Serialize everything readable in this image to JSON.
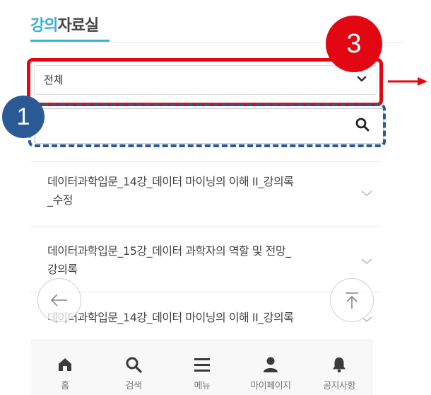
{
  "page": {
    "title_highlight": "강의",
    "title_rest": "자료실"
  },
  "annotations": {
    "badge_3": "3",
    "badge_1": "1",
    "select_box_color": "#e30613",
    "search_box_color": "#2a5a96"
  },
  "filter": {
    "selected": "전체"
  },
  "search": {
    "placeholder": ""
  },
  "list": {
    "items": [
      {
        "line1": "데이터과학입문_14강_데이터 마이닝의 이해 II_강의록",
        "line2": "_수정"
      },
      {
        "line1": "데이터과학입문_15강_데이터 과학자의 역할 및 전망_",
        "line2": "강의록"
      },
      {
        "line1": "데이터과학입문_14강_데이터 마이닝의 이해 II_강의록",
        "line2": ""
      }
    ]
  },
  "floating": {
    "back_icon": "arrow-left-icon",
    "top_icon": "arrow-up-to-top-icon"
  },
  "tabbar": {
    "tabs": [
      {
        "label": "홈",
        "icon": "home-icon"
      },
      {
        "label": "검색",
        "icon": "search-icon"
      },
      {
        "label": "메뉴",
        "icon": "menu-icon"
      },
      {
        "label": "마이페이지",
        "icon": "user-icon"
      },
      {
        "label": "공지사항",
        "icon": "bell-icon"
      }
    ]
  },
  "colors": {
    "accent": "#3ab0d8",
    "annotation_red": "#e30613",
    "annotation_blue": "#2a5a96"
  }
}
